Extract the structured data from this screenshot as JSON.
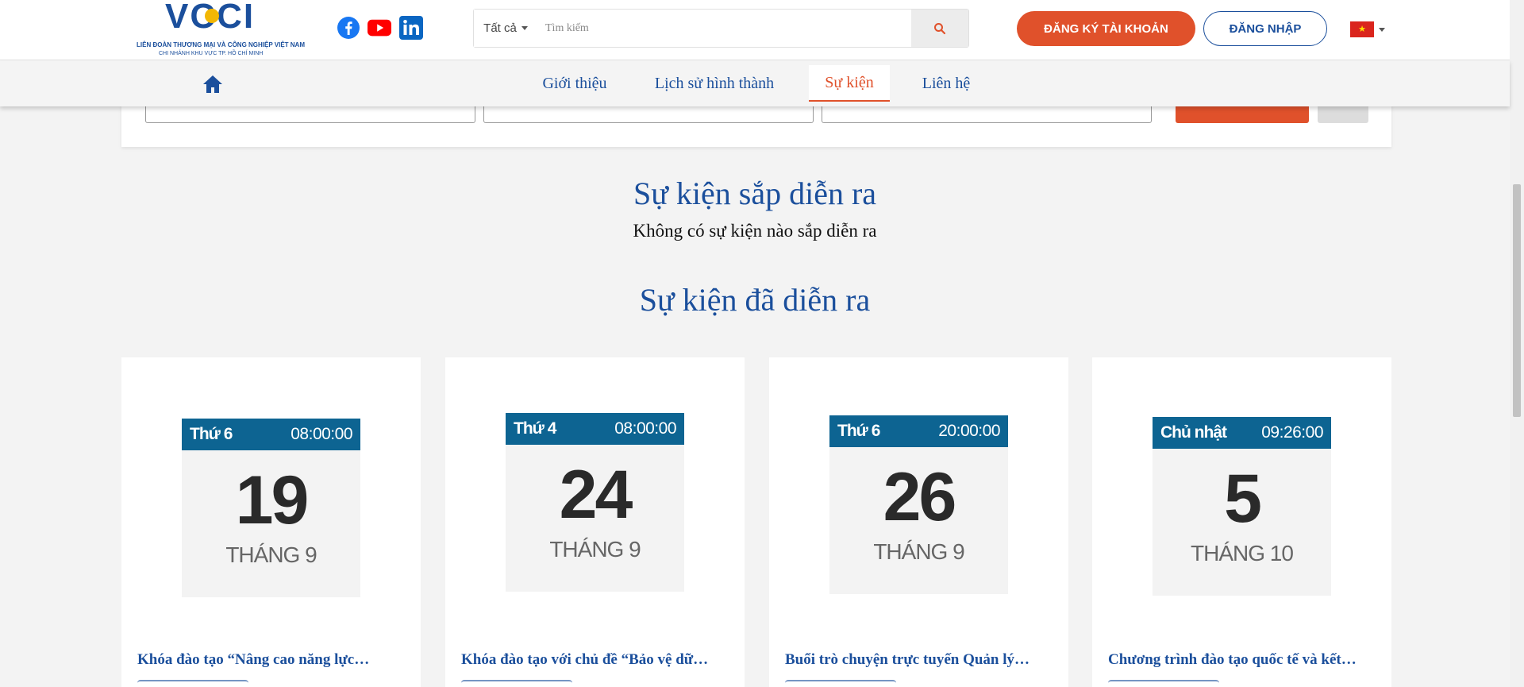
{
  "header": {
    "logo": {
      "wordmark": "VCCI",
      "line1": "LIÊN ĐOÀN THƯƠNG MẠI VÀ CÔNG NGHIỆP VIỆT NAM",
      "line2": "CHI NHÁNH KHU VỰC TP. HỒ CHÍ MINH"
    },
    "social": [
      "facebook-icon",
      "youtube-icon",
      "linkedin-icon"
    ],
    "search": {
      "category": "Tất cả",
      "placeholder": "Tìm kiếm"
    },
    "register_label": "ĐĂNG KÝ TÀI KHOẢN",
    "login_label": "ĐĂNG NHẬP",
    "language_flag": "vietnam-flag-icon"
  },
  "nav": {
    "items": [
      {
        "label": "Giới thiệu"
      },
      {
        "label": "Lịch sử hình thành"
      },
      {
        "label": "Sự kiện",
        "active": true
      },
      {
        "label": "Liên hệ"
      }
    ]
  },
  "upcoming": {
    "title": "Sự kiện sắp diễn ra",
    "empty_message": "Không có sự kiện nào sắp diễn ra"
  },
  "past": {
    "title": "Sự kiện đã diễn ra",
    "events": [
      {
        "weekday": "Thứ 6",
        "time": "08:00:00",
        "day": "19",
        "month": "THÁNG 9",
        "title": "Khóa đào tạo “Nâng cao năng lực…"
      },
      {
        "weekday": "Thứ 4",
        "time": "08:00:00",
        "day": "24",
        "month": "THÁNG 9",
        "title": "Khóa đào tạo với chủ đề “Bảo vệ dữ…"
      },
      {
        "weekday": "Thứ 6",
        "time": "20:00:00",
        "day": "26",
        "month": "THÁNG 9",
        "title": "Buổi trò chuyện trực tuyến Quản lý…"
      },
      {
        "weekday": "Chủ nhật",
        "time": "09:26:00",
        "day": "5",
        "month": "THÁNG 10",
        "title": "Chương trình đào tạo quốc tế và kết…"
      }
    ]
  },
  "colors": {
    "brand_blue": "#1b4f9c",
    "accent_orange": "#e0512b",
    "calendar_header": "#0d6492"
  }
}
